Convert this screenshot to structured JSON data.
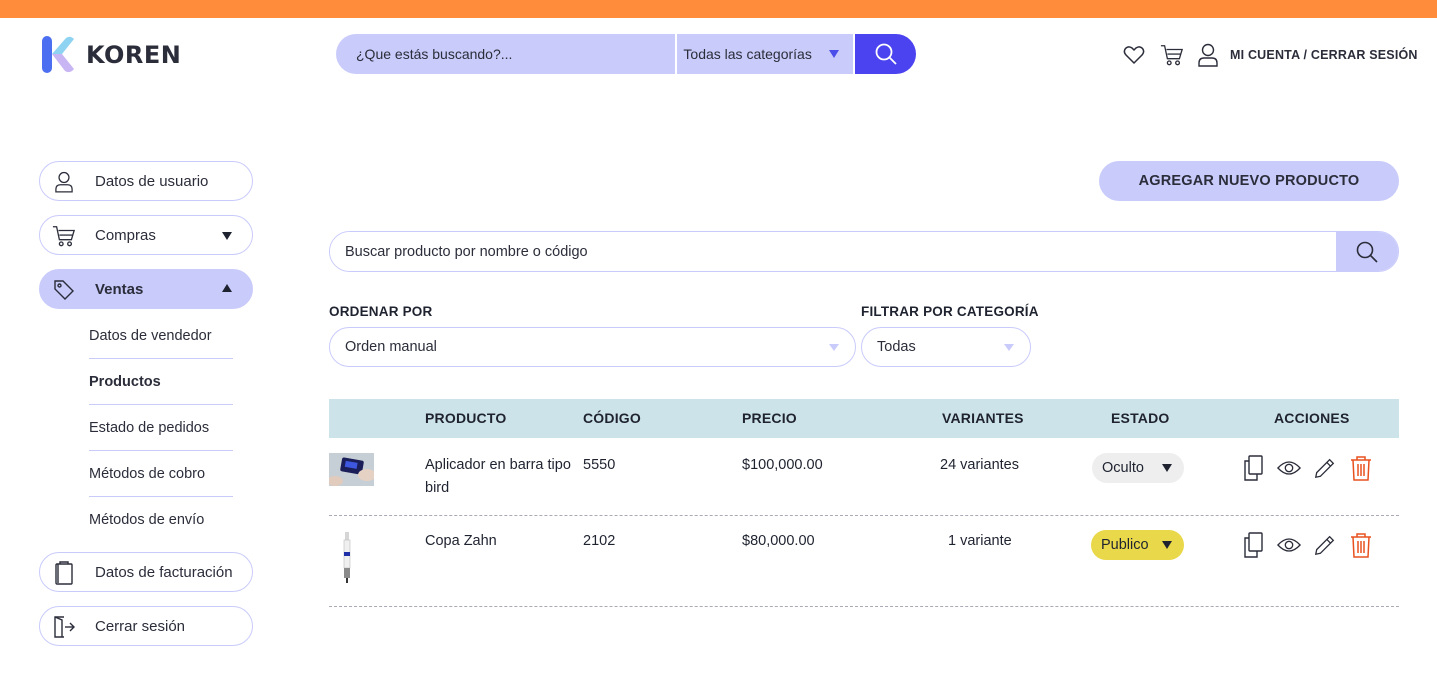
{
  "brand": {
    "name": "KOREN",
    "accent": "#ff8c3a",
    "primary": "#4b43f0",
    "soft": "#c9cbfb"
  },
  "header": {
    "search_placeholder": "¿Que estás buscando?...",
    "category_select": "Todas las categorías",
    "icons": [
      "heart-icon",
      "cart-icon",
      "user-icon"
    ],
    "account_link": "MI CUENTA / CERRAR SESIÓN"
  },
  "sidebar": {
    "items": [
      {
        "label": "Datos de usuario",
        "icon": "user-icon"
      },
      {
        "label": "Compras",
        "icon": "cart-icon",
        "expanded": false
      },
      {
        "label": "Ventas",
        "icon": "tag-icon",
        "expanded": true
      },
      {
        "label": "Datos de facturación",
        "icon": "clipboard-icon"
      },
      {
        "label": "Cerrar sesión",
        "icon": "logout-icon"
      }
    ],
    "ventas_sub": [
      {
        "label": "Datos de vendedor"
      },
      {
        "label": "Productos",
        "selected": true
      },
      {
        "label": "Estado de pedidos"
      },
      {
        "label": "Métodos de cobro"
      },
      {
        "label": "Métodos de envío"
      }
    ]
  },
  "main": {
    "add_button": "AGREGAR NUEVO PRODUCTO",
    "product_search_placeholder": "Buscar producto por nombre o código",
    "sort": {
      "label": "ORDENAR POR",
      "value": "Orden manual"
    },
    "filter": {
      "label": "FILTRAR POR CATEGORÍA",
      "value": "Todas"
    },
    "table": {
      "headers": [
        "PRODUCTO",
        "CÓDIGO",
        "PRECIO",
        "VARIANTES",
        "ESTADO",
        "ACCIONES"
      ],
      "rows": [
        {
          "name": "Aplicador en barra tipo bird",
          "code": "5550",
          "price": "$100,000.00",
          "variants": "24 variantes",
          "status": "Oculto",
          "status_color": "#eeeeee"
        },
        {
          "name": "Copa Zahn",
          "code": "2102",
          "price": "$80,000.00",
          "variants": "1 variante",
          "status": "Publico",
          "status_color": "#e9d84a"
        }
      ],
      "actions": [
        "copy-icon",
        "eye-icon",
        "pencil-icon",
        "trash-icon"
      ]
    }
  }
}
